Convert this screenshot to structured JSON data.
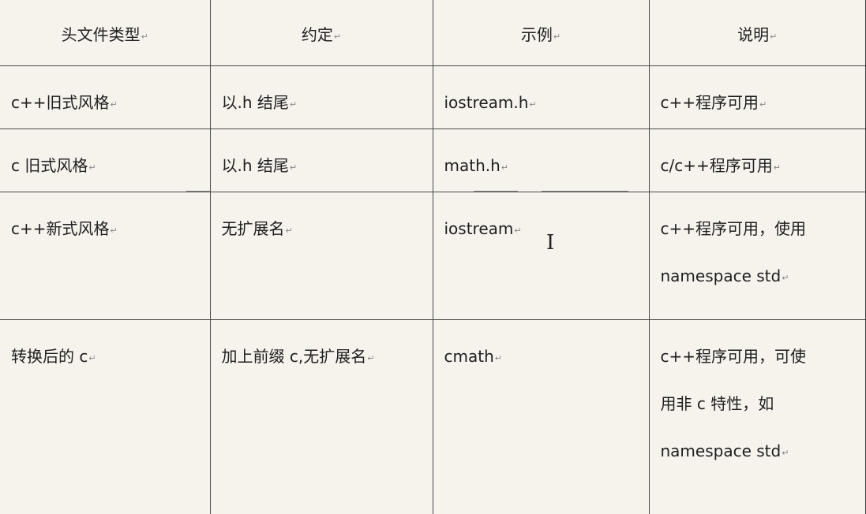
{
  "table": {
    "headers": [
      "头文件类型",
      "约定",
      "示例",
      "说明"
    ],
    "rows": [
      {
        "type": "c++旧式风格",
        "convention": "以.h 结尾",
        "example": "iostream.h",
        "description": [
          "c++程序可用"
        ]
      },
      {
        "type": "c 旧式风格",
        "convention": "以.h 结尾",
        "example": "math.h",
        "description": [
          "c/c++程序可用"
        ]
      },
      {
        "type": "c++新式风格",
        "convention": "无扩展名",
        "example": "iostream",
        "description": [
          "c++程序可用，使用",
          "namespace std"
        ]
      },
      {
        "type": "转换后的 c",
        "convention": "加上前缀 c,无扩展名",
        "example": "cmath",
        "description": [
          "c++程序可用，可使",
          "用非 c 特性，如",
          "namespace std"
        ]
      }
    ]
  },
  "paragraph_mark": "↵",
  "text_cursor": "I"
}
